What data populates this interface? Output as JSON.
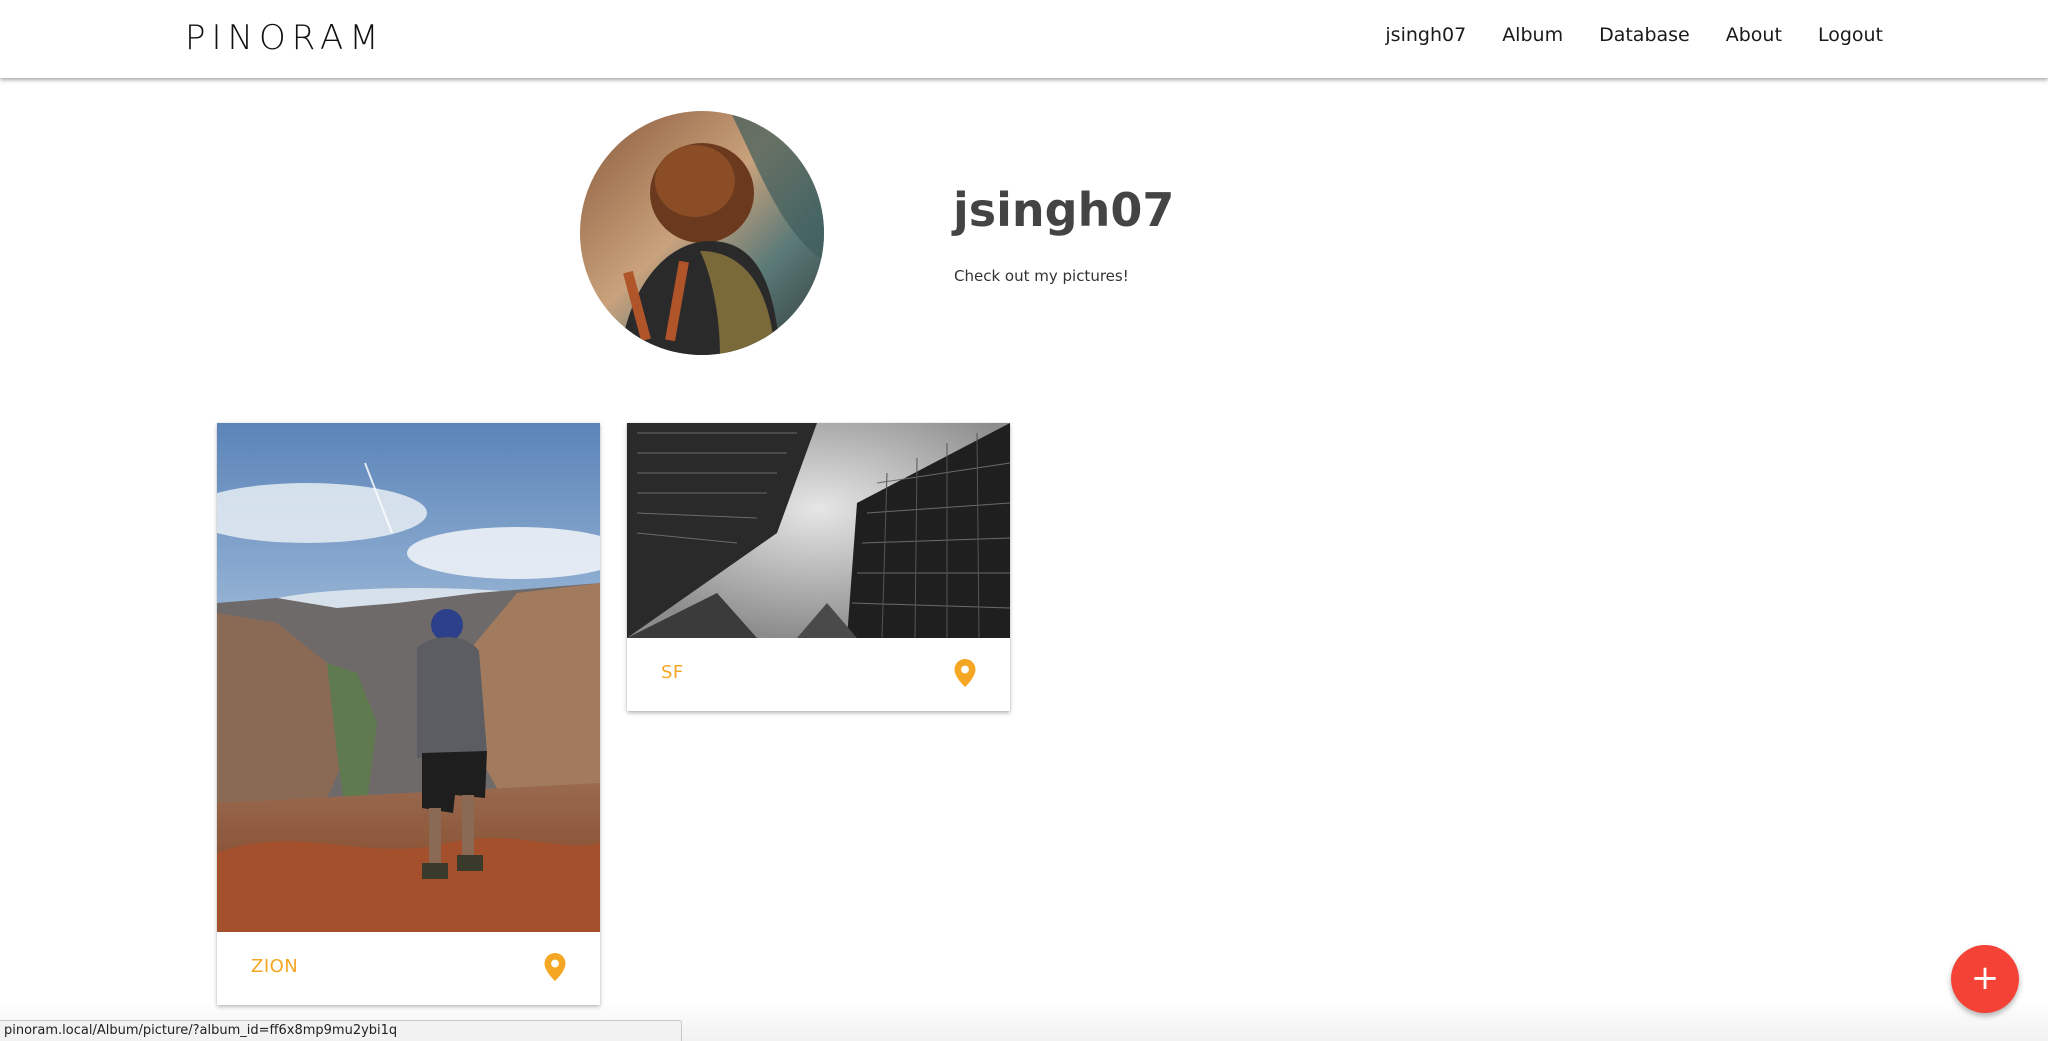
{
  "navbar": {
    "brand": "PINORAM",
    "links": [
      {
        "label": "jsingh07"
      },
      {
        "label": "Album"
      },
      {
        "label": "Database"
      },
      {
        "label": "About"
      },
      {
        "label": "Logout"
      }
    ]
  },
  "profile": {
    "username": "jsingh07",
    "bio": "Check out my pictures!"
  },
  "albums": [
    {
      "title": "ZION",
      "icon": "location-pin-icon"
    },
    {
      "title": "SF",
      "icon": "location-pin-icon"
    }
  ],
  "fab": {
    "label": "+"
  },
  "status_bar": {
    "url": "pinoram.local/Album/picture/?album_id=ff6x8mp9mu2ybi1q"
  },
  "colors": {
    "accent": "#f5a623",
    "fab": "#f44336",
    "title_text": "#444444"
  }
}
